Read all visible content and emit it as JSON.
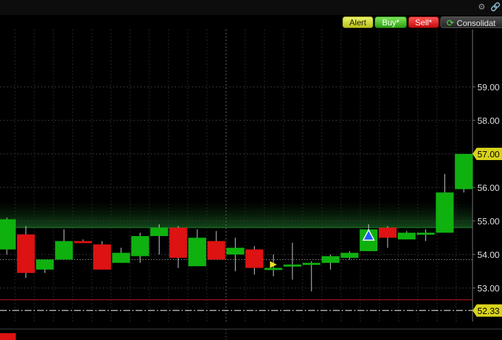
{
  "header": {
    "settings_icon": "gear-icon",
    "link_icon": "link-icon"
  },
  "toolbar": {
    "alert_label": "Alert",
    "buy_label": "Buy*",
    "sell_label": "Sell*",
    "consolidated_label": "Consolidat",
    "refresh_icon": "refresh-icon"
  },
  "colors": {
    "up": "#0fb10f",
    "down": "#dd1212",
    "background": "#000000",
    "price_tag": "#d8d21b",
    "support_line": "#cc2222"
  },
  "chart_data": {
    "type": "candlestick",
    "y_ticks": [
      "59.00",
      "58.00",
      "57.00",
      "56.00",
      "55.00",
      "54.00",
      "53.00"
    ],
    "ylim": [
      52.0,
      60.4
    ],
    "last_price_label": "57.00",
    "last_price": 57.0,
    "reference_label": "52.33",
    "reference_price": 52.33,
    "support_price": 52.65,
    "shaded_band": [
      54.8,
      55.6
    ],
    "candles": [
      {
        "o": 54.15,
        "h": 55.1,
        "l": 54.0,
        "c": 55.05
      },
      {
        "o": 54.6,
        "h": 54.85,
        "l": 53.3,
        "c": 53.45
      },
      {
        "o": 53.55,
        "h": 53.75,
        "l": 53.45,
        "c": 53.85
      },
      {
        "o": 53.85,
        "h": 54.75,
        "l": 53.85,
        "c": 54.4
      },
      {
        "o": 54.4,
        "h": 54.45,
        "l": 54.35,
        "c": 54.35
      },
      {
        "o": 54.3,
        "h": 54.4,
        "l": 53.55,
        "c": 53.55
      },
      {
        "o": 53.75,
        "h": 54.2,
        "l": 53.75,
        "c": 54.05
      },
      {
        "o": 53.95,
        "h": 54.65,
        "l": 53.75,
        "c": 54.55
      },
      {
        "o": 54.55,
        "h": 54.9,
        "l": 54.0,
        "c": 54.8
      },
      {
        "o": 54.8,
        "h": 54.85,
        "l": 53.6,
        "c": 53.9
      },
      {
        "o": 53.65,
        "h": 54.75,
        "l": 53.65,
        "c": 54.5
      },
      {
        "o": 54.4,
        "h": 54.7,
        "l": 53.85,
        "c": 53.85
      },
      {
        "o": 54.0,
        "h": 54.5,
        "l": 53.5,
        "c": 54.2
      },
      {
        "o": 54.15,
        "h": 54.25,
        "l": 53.4,
        "c": 53.6
      },
      {
        "o": 53.55,
        "h": 54.0,
        "l": 53.35,
        "c": 53.6
      },
      {
        "o": 53.65,
        "h": 54.35,
        "l": 53.25,
        "c": 53.7
      },
      {
        "o": 53.72,
        "h": 53.8,
        "l": 52.9,
        "c": 53.75
      },
      {
        "o": 53.75,
        "h": 54.0,
        "l": 53.55,
        "c": 53.95
      },
      {
        "o": 53.9,
        "h": 54.1,
        "l": 53.85,
        "c": 54.05
      },
      {
        "o": 54.1,
        "h": 54.9,
        "l": 54.1,
        "c": 54.75
      },
      {
        "o": 54.8,
        "h": 54.85,
        "l": 54.2,
        "c": 54.5
      },
      {
        "o": 54.45,
        "h": 54.7,
        "l": 54.45,
        "c": 54.65
      },
      {
        "o": 54.6,
        "h": 54.75,
        "l": 54.4,
        "c": 54.65
      },
      {
        "o": 54.65,
        "h": 56.4,
        "l": 54.65,
        "c": 55.85
      },
      {
        "o": 55.95,
        "h": 57.0,
        "l": 55.85,
        "c": 57.0
      }
    ],
    "markers": [
      {
        "type": "arrow-right",
        "candle": 14,
        "price": 53.7,
        "color": "#f0e020"
      },
      {
        "type": "triangle-up",
        "candle": 19,
        "price": 54.55,
        "color": "#1e5bff"
      }
    ],
    "volume_bars": [
      {
        "candle": 0,
        "value": 1,
        "color": "#dd1212"
      }
    ]
  }
}
